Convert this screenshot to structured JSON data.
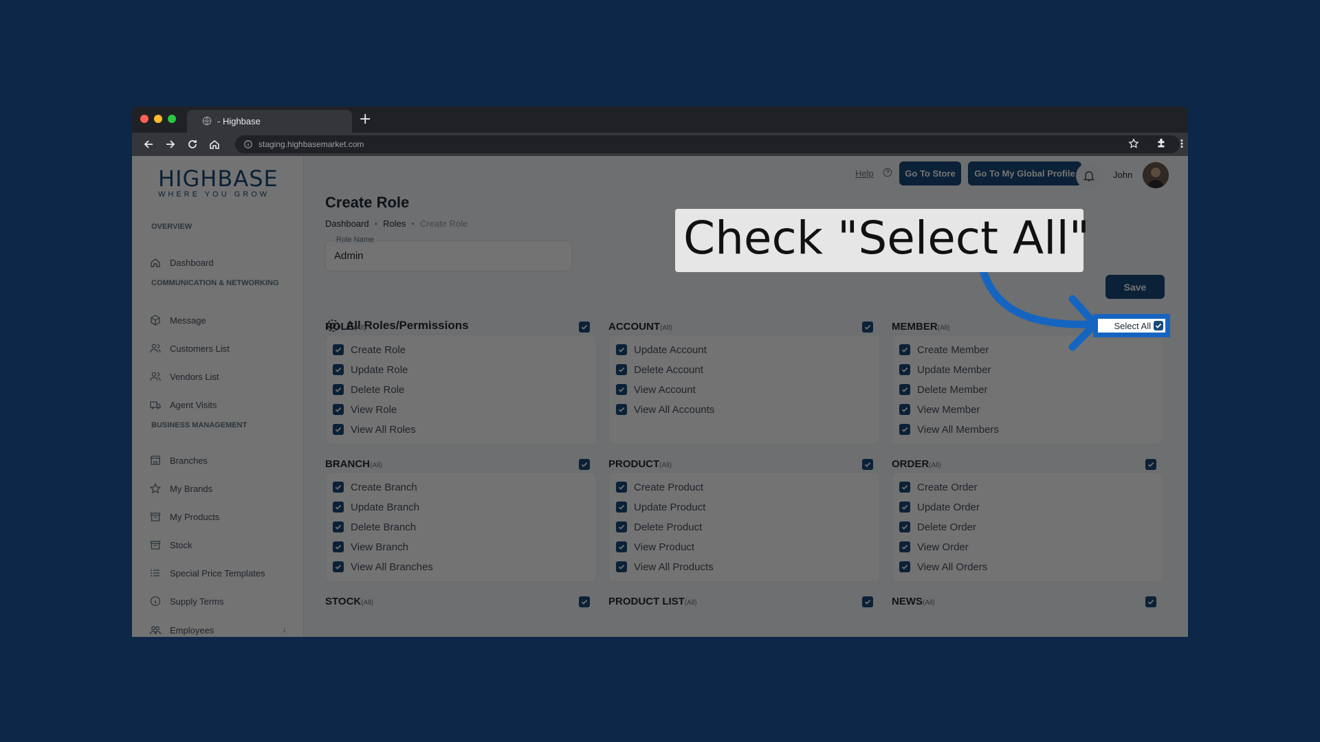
{
  "browser": {
    "tab_title": "- Highbase",
    "url": "staging.highbasemarket.com"
  },
  "logo": {
    "brand": "HIGHBASE",
    "tagline": "WHERE YOU GROW"
  },
  "sidebar": {
    "sections": [
      "OVERVIEW",
      "COMMUNICATION & NETWORKING",
      "BUSINESS MANAGEMENT"
    ],
    "items": [
      {
        "label": "Dashboard",
        "icon": "home-icon"
      },
      {
        "label": "Message",
        "icon": "cube-icon"
      },
      {
        "label": "Customers List",
        "icon": "users-icon"
      },
      {
        "label": "Vendors List",
        "icon": "users-icon"
      },
      {
        "label": "Agent Visits",
        "icon": "truck-icon"
      },
      {
        "label": "Branches",
        "icon": "store-icon"
      },
      {
        "label": "My Brands",
        "icon": "star-icon"
      },
      {
        "label": "My Products",
        "icon": "box-icon"
      },
      {
        "label": "Stock",
        "icon": "box-icon"
      },
      {
        "label": "Special Price Templates",
        "icon": "list-icon"
      },
      {
        "label": "Supply Terms",
        "icon": "info-icon"
      },
      {
        "label": "Employees",
        "icon": "people-icon"
      }
    ]
  },
  "header": {
    "help": "Help",
    "go_to_store": "Go To Store",
    "go_to_profile": "Go To My Global Profile",
    "user_name": "John"
  },
  "main": {
    "title": "Create Role",
    "breadcrumb": [
      "Dashboard",
      "Roles",
      "Create Role"
    ],
    "role_name_label": "Role Name",
    "role_name_value": "Admin",
    "save": "Save",
    "permissions_heading": "All Roles/Permissions",
    "select_all": "Select All",
    "all_suffix": "(All)",
    "groups": [
      {
        "name": "ROLE",
        "items": [
          "Create Role",
          "Update Role",
          "Delete Role",
          "View Role",
          "View All Roles"
        ]
      },
      {
        "name": "ACCOUNT",
        "items": [
          "Update Account",
          "Delete Account",
          "View Account",
          "View All Accounts"
        ]
      },
      {
        "name": "MEMBER",
        "items": [
          "Create Member",
          "Update Member",
          "Delete Member",
          "View Member",
          "View All Members"
        ]
      },
      {
        "name": "BRANCH",
        "items": [
          "Create Branch",
          "Update Branch",
          "Delete Branch",
          "View Branch",
          "View All Branches"
        ]
      },
      {
        "name": "PRODUCT",
        "items": [
          "Create Product",
          "Update Product",
          "Delete Product",
          "View Product",
          "View All Products"
        ]
      },
      {
        "name": "ORDER",
        "items": [
          "Create Order",
          "Update Order",
          "Delete Order",
          "View Order",
          "View All Orders"
        ]
      },
      {
        "name": "STOCK",
        "items": []
      },
      {
        "name": "PRODUCT LIST",
        "items": []
      },
      {
        "name": "NEWS",
        "items": []
      }
    ]
  },
  "annotation": {
    "text": "Check \"Select All\""
  },
  "colors": {
    "brand": "#1a4a7a",
    "background": "#0c2748",
    "highlight": "#1565c0"
  }
}
